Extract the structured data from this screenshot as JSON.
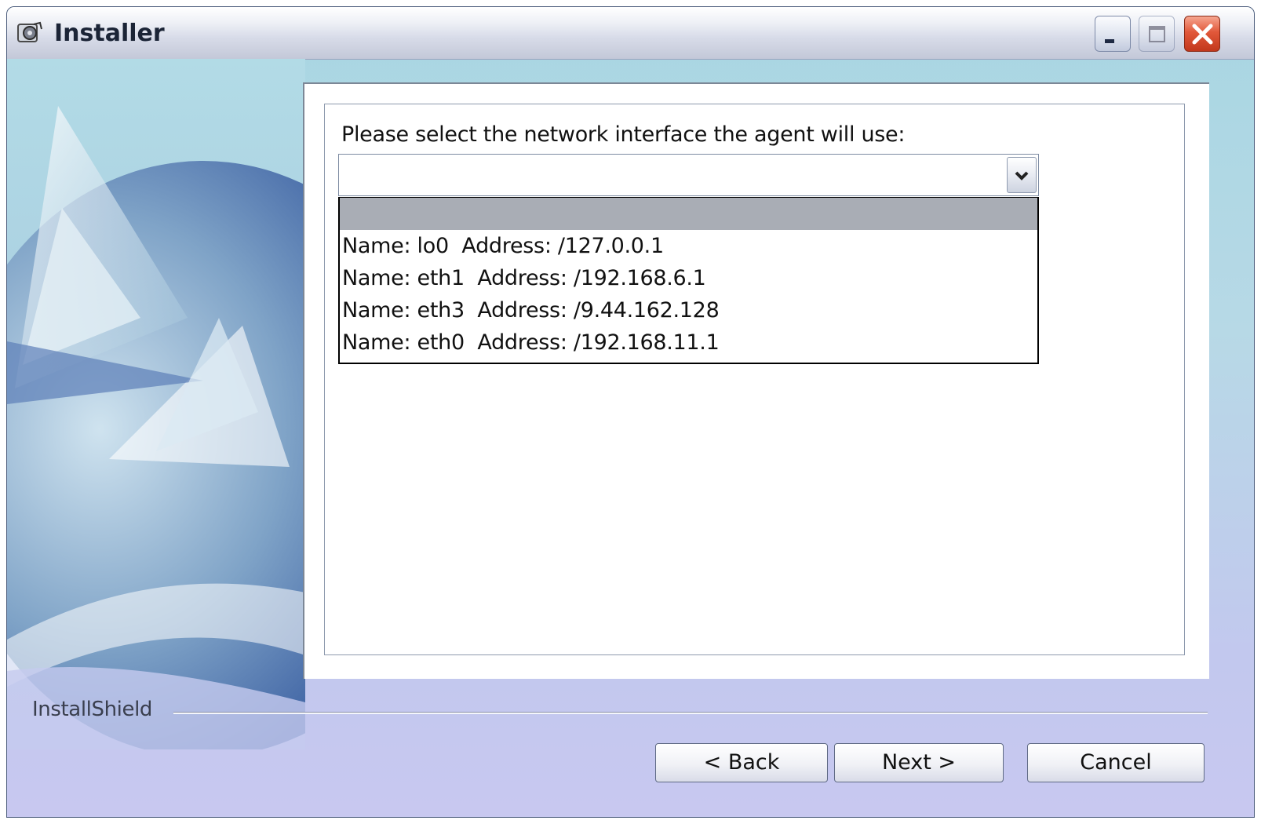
{
  "window": {
    "title": "Installer",
    "icon": "installer-app-icon",
    "controls": [
      "minimize-icon",
      "maximize-icon",
      "close-icon"
    ]
  },
  "main": {
    "prompt": "Please select the network interface the agent will use:",
    "combo": {
      "selected_value": "",
      "arrow_icon": "chevron-down-icon"
    },
    "dropdown": {
      "highlighted_index": 0,
      "options": [
        "",
        "Name: lo0  Address: /127.0.0.1",
        "Name: eth1  Address: /192.168.6.1",
        "Name: eth3  Address: /9.44.162.128",
        "Name: eth0  Address: /192.168.11.1"
      ]
    }
  },
  "footer": {
    "brand": "InstallShield",
    "back_label": "< Back",
    "next_label": "Next >",
    "cancel_label": "Cancel"
  },
  "colors": {
    "selection": "#a9adb5",
    "close_button": "#e1583a"
  }
}
